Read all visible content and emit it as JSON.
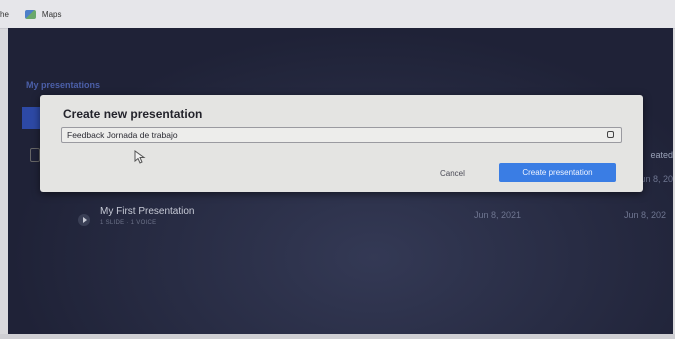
{
  "bookmarks": {
    "partial_label": "he",
    "maps_label": "Maps"
  },
  "page": {
    "section_title": "My presentations",
    "column_header_partial": "eated",
    "row_date_partial": "Jun 8, 20"
  },
  "presentations": [
    {
      "title": "My First Presentation",
      "meta": "1 SLIDE · 1 VOICE",
      "updated": "Jun 8, 2021",
      "created": "Jun 8, 202"
    }
  ],
  "dialog": {
    "title": "Create new presentation",
    "input_value": "Feedback Jornada de trabajo",
    "cancel_label": "Cancel",
    "create_label": "Create presentation"
  },
  "colors": {
    "accent": "#3a7de4",
    "background": "#1f2237",
    "dialog": "#e4e4e2"
  }
}
